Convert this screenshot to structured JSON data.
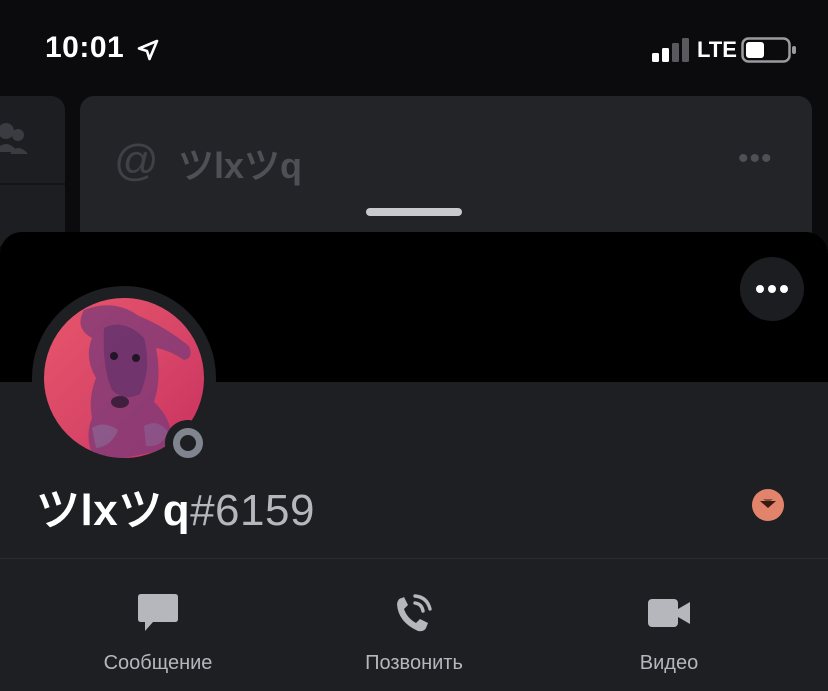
{
  "status_bar": {
    "time": "10:01",
    "network": "LTE",
    "icons": [
      "location-arrow-icon",
      "signal-bars-icon",
      "battery-icon"
    ]
  },
  "background_channel": {
    "icon": "at-sign-icon",
    "at_symbol": "@",
    "name": "ツlxツq",
    "more_icon": "ellipsis-icon"
  },
  "profile": {
    "username": "ツlxツq",
    "discriminator": "#6159",
    "status": "offline",
    "badge_icon": "chevron-down-badge-icon",
    "more_icon": "ellipsis-icon"
  },
  "actions": [
    {
      "label": "Сообщение",
      "icon": "chat-bubble-icon"
    },
    {
      "label": "Позвонить",
      "icon": "phone-call-icon"
    },
    {
      "label": "Видео",
      "icon": "video-camera-icon"
    }
  ],
  "colors": {
    "sheet_background": "#1e1f22",
    "banner": "#000000",
    "status_offline": "#80848e",
    "badge": "#e2846b",
    "muted_text": "#b5b7bc"
  }
}
